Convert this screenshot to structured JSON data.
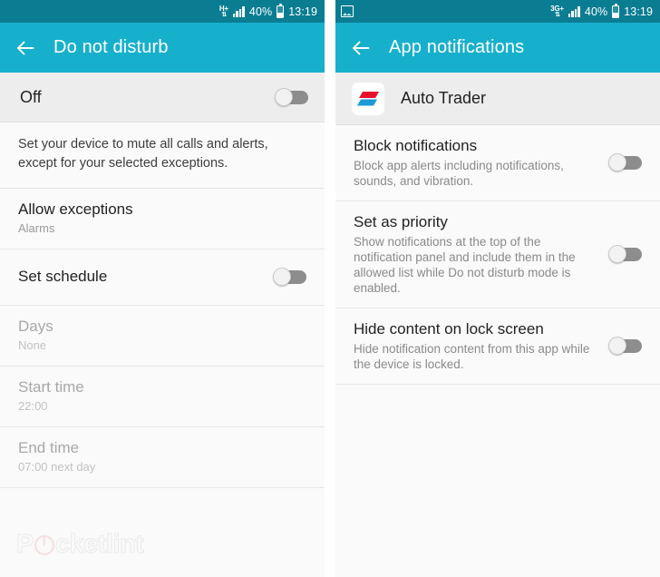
{
  "left": {
    "statusbar": {
      "network_label": "H+",
      "network_arrows": "⇅",
      "battery_text": "40%",
      "clock": "13:19"
    },
    "appbar": {
      "title": "Do not disturb",
      "back_icon": "arrow-left-icon"
    },
    "master": {
      "label": "Off",
      "toggle_state": "off"
    },
    "description": "Set your device to mute all calls and alerts, except for your selected exceptions.",
    "items": [
      {
        "title": "Allow exceptions",
        "sub": "Alarms",
        "disabled": false,
        "has_toggle": false
      },
      {
        "title": "Set schedule",
        "sub": "",
        "disabled": false,
        "has_toggle": true,
        "toggle_state": "off"
      },
      {
        "title": "Days",
        "sub": "None",
        "disabled": true,
        "has_toggle": false
      },
      {
        "title": "Start time",
        "sub": "22:00",
        "disabled": true,
        "has_toggle": false
      },
      {
        "title": "End time",
        "sub": "07:00 next day",
        "disabled": true,
        "has_toggle": false
      }
    ],
    "watermark": {
      "part1": "P",
      "part2": "cketlint"
    }
  },
  "right": {
    "statusbar": {
      "left_icon": "screenshot-icon",
      "network_label": "3G+",
      "network_arrows": "⇅",
      "battery_text": "40%",
      "clock": "13:19"
    },
    "appbar": {
      "title": "App notifications",
      "back_icon": "arrow-left-icon"
    },
    "app": {
      "name": "Auto Trader",
      "icon": "auto-trader-app-icon"
    },
    "items": [
      {
        "title": "Block notifications",
        "sub": "Block app alerts including notifications, sounds, and vibration.",
        "toggle_state": "off"
      },
      {
        "title": "Set as priority",
        "sub": "Show notifications at the top of the notification panel and include them in the allowed list while Do not disturb mode is enabled.",
        "toggle_state": "off"
      },
      {
        "title": "Hide content on lock screen",
        "sub": "Hide notification content from this app while the device is locked.",
        "toggle_state": "off"
      }
    ]
  },
  "colors": {
    "statusbar_bg": "#0a7d92",
    "appbar_bg": "#17b0cc",
    "content_bg": "#fafafa",
    "master_row_bg": "#ededed",
    "toggle_track_off": "#8d8d8d",
    "app_icon_red": "#e8112d",
    "app_icon_blue": "#1b9ad6"
  }
}
